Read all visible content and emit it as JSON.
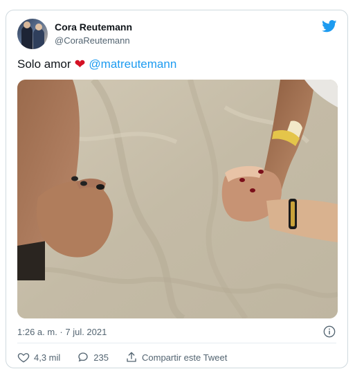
{
  "author": {
    "name": "Cora Reutemann",
    "handle": "@CoraReutemann"
  },
  "tweet": {
    "text": "Solo amor",
    "emoji": "❤",
    "mention": "@matreutemann"
  },
  "meta": {
    "timestamp": "1:26 a. m. · 7 jul. 2021"
  },
  "actions": {
    "likes": "4,3 mil",
    "replies": "235",
    "share_label": "Compartir este Tweet"
  },
  "icons": {
    "brand": "twitter-bird-icon",
    "info": "info-icon",
    "like": "heart-icon",
    "reply": "reply-icon",
    "share": "share-icon"
  },
  "colors": {
    "accent": "#1d9bf0",
    "heart": "#d41124",
    "muted_text": "#536471"
  }
}
